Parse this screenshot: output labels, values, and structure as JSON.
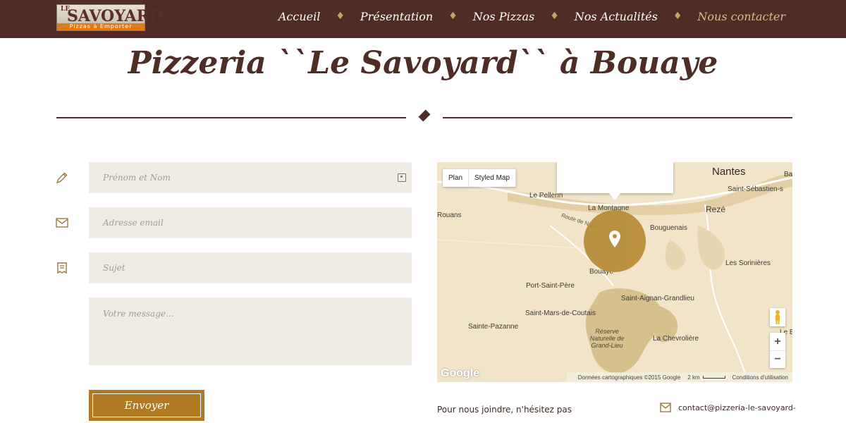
{
  "header": {
    "logo": {
      "prefix": "LE",
      "name": "SAVOYARD",
      "tagline": "Pizzas à Emporter"
    },
    "nav": [
      {
        "label": "Accueil",
        "active": false
      },
      {
        "label": "Présentation",
        "active": false
      },
      {
        "label": "Nos Pizzas",
        "active": false
      },
      {
        "label": "Nos Actualités",
        "active": false
      },
      {
        "label": "Nous contacter",
        "active": true
      }
    ]
  },
  "page": {
    "title": "Pizzeria ``Le Savoyard`` à Bouaye"
  },
  "form": {
    "name_placeholder": "Prénom et Nom",
    "email_placeholder": "Adresse email",
    "subject_placeholder": "Sujet",
    "message_placeholder": "Votre message...",
    "send_label": "Envoyer"
  },
  "map": {
    "controls": {
      "plan": "Plan",
      "styled": "Styled Map"
    },
    "labels": {
      "nantes": "Nantes",
      "saint_sebastien": "Saint-Sébastien-s",
      "le_pellerin": "Le Pellerin",
      "la_montagne": "La Montagne",
      "reze": "Rezé",
      "rouans": "Rouans",
      "route_de_nantes": "Route de Nantes",
      "bouguenais": "Bouguenais",
      "bouaye": "Bouaye",
      "les_sorinieres": "Les Sorinières",
      "port_saint_pere": "Port-Saint-Père",
      "saint_aignan": "Saint-Aignan-Grandlieu",
      "saint_mars": "Saint-Mars-de-Coutais",
      "sainte_pazanne": "Sainte-Pazanne",
      "reserve": "Réserve Naturelle de Grand-Lieu",
      "la_chevroliere": "La Chevrolière",
      "le_bi": "Le Bi",
      "ba": "Ba"
    },
    "google": "Google",
    "footer": {
      "data": "Données cartographiques ©2015 Google",
      "scale": "2 km",
      "terms": "Conditions d'utilisation"
    },
    "zoom_in": "+",
    "zoom_out": "−"
  },
  "contact": {
    "intro": "Pour nous joindre, n'hésitez pas",
    "email": "contact@pizzeria-le-savoyard-"
  },
  "colors": {
    "header_bg": "#4f2c26",
    "accent_gold": "#b07a22",
    "field_bg": "#f0ece5",
    "marker": "#b88d3a",
    "map_bg": "#f1e4c8"
  }
}
